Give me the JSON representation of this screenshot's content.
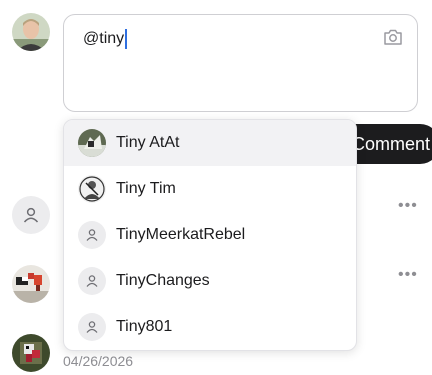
{
  "composer": {
    "text": "@tiny",
    "camera_icon": "camera-icon"
  },
  "comment_button": {
    "label": "Comment"
  },
  "comments": [
    {
      "avatar": "generic-user-avatar",
      "more_icon": "more-horizontal-icon"
    },
    {
      "avatar": "pixel-art-avatar",
      "more_icon": "more-horizontal-icon"
    },
    {
      "avatar": "pixel-art-avatar",
      "date": "04/26/2026"
    }
  ],
  "mention_suggestions": [
    {
      "name": "Tiny AtAt",
      "avatar": "photo",
      "highlighted": true
    },
    {
      "name": "Tiny Tim",
      "avatar": "photo",
      "highlighted": false
    },
    {
      "name": "TinyMeerkatRebel",
      "avatar": "generic-user-icon",
      "highlighted": false
    },
    {
      "name": "TinyChanges",
      "avatar": "generic-user-icon",
      "highlighted": false
    },
    {
      "name": "Tiny801",
      "avatar": "generic-user-icon",
      "highlighted": false
    }
  ],
  "colors": {
    "button_bg": "#1c1c1e",
    "caret": "#2f6fe0",
    "muted_text": "#8e8e93",
    "highlight_bg": "#f2f2f4"
  }
}
